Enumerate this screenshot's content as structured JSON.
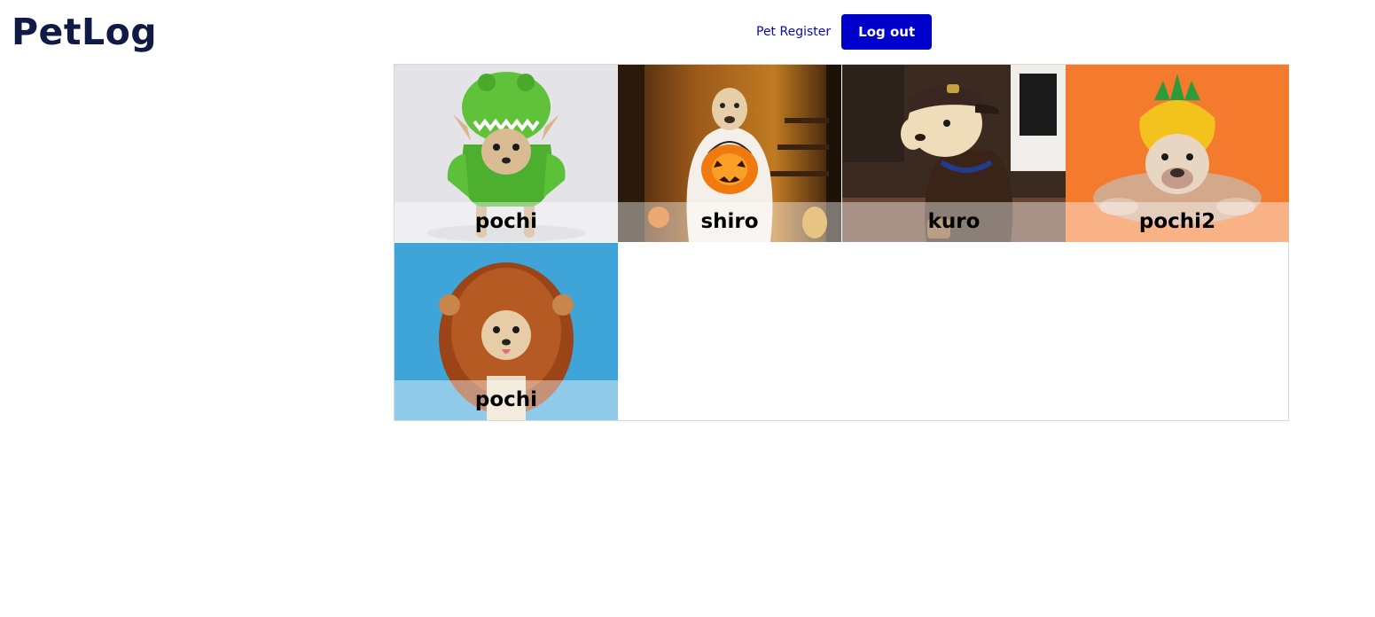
{
  "header": {
    "app_title": "PetLog",
    "nav_register_label": "Pet Register",
    "logout_label": "Log out",
    "logout_color": "#0000cc",
    "title_color": "#0f1b45"
  },
  "pets": [
    {
      "name": "pochi",
      "photo": "chihuahua in green dinosaur costume",
      "background": "#e6e6ea"
    },
    {
      "name": "shiro",
      "photo": "dog in white ghost costume holding jack-o-lantern",
      "background": "#6b3a12"
    },
    {
      "name": "kuro",
      "photo": "labrador in brown delivery uniform and cap",
      "background": "#3a2a22"
    },
    {
      "name": "pochi2",
      "photo": "bulldog in yellow pineapple costume",
      "background": "#f47a2e"
    },
    {
      "name": "pochi",
      "photo": "chihuahua in lion mane costume",
      "background": "#3fa4d8"
    }
  ]
}
